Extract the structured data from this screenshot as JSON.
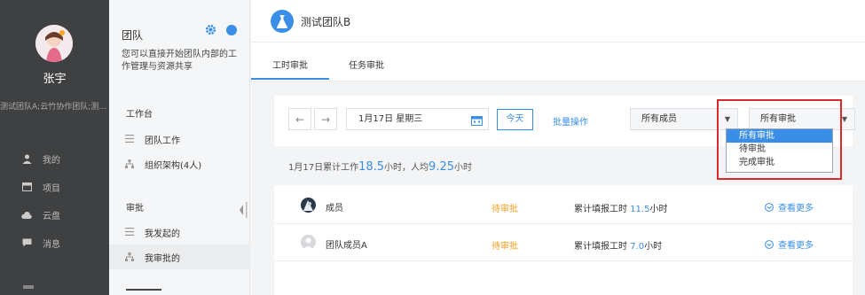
{
  "user": {
    "name": "张宇",
    "teams": "测试团队A;云竹协作团队;测试..."
  },
  "left_nav": {
    "items": [
      {
        "label": "我的",
        "icon": "person-icon"
      },
      {
        "label": "项目",
        "icon": "calendar-icon"
      },
      {
        "label": "云盘",
        "icon": "cloud-icon"
      },
      {
        "label": "消息",
        "icon": "chat-icon"
      }
    ]
  },
  "team_panel": {
    "title": "团队",
    "description": "您可以直接开始团队内部的工作管理与资源共享",
    "workbench_heading": "工作台",
    "workbench_items": [
      {
        "label": "团队工作"
      },
      {
        "label": "组织架构(4人)"
      }
    ],
    "approval_heading": "审批",
    "approval_items": [
      {
        "label": "我发起的"
      },
      {
        "label": "我审批的"
      }
    ]
  },
  "main": {
    "team_name": "测试团队B",
    "tabs": [
      {
        "label": "工时审批"
      },
      {
        "label": "任务审批"
      }
    ],
    "toolbar": {
      "date": "1月17日 星期三",
      "today_label": "今天",
      "batch_label": "批量操作",
      "members_select": "所有成员",
      "approval_select": "所有审批"
    },
    "summary": {
      "prefix": "1月17日累计工作",
      "total": "18.5",
      "mid": "小时，人均",
      "avg": "9.25",
      "suffix": "小时"
    },
    "rows": [
      {
        "name": "成员",
        "status": "待审批",
        "hours_label": "累计填报工时",
        "hours": "11.5",
        "unit": "小时",
        "more": "查看更多"
      },
      {
        "name": "团队成员A",
        "status": "待审批",
        "hours_label": "累计填报工时",
        "hours": "7.0",
        "unit": "小时",
        "more": "查看更多"
      }
    ]
  },
  "dropdown": {
    "options": [
      "所有审批",
      "待审批",
      "完成审批"
    ],
    "selected_index": 0
  },
  "colors": {
    "accent": "#3a8ee6",
    "pending": "#f0a020",
    "sidebar": "#3f4041",
    "highlight": "#d92b2b"
  }
}
